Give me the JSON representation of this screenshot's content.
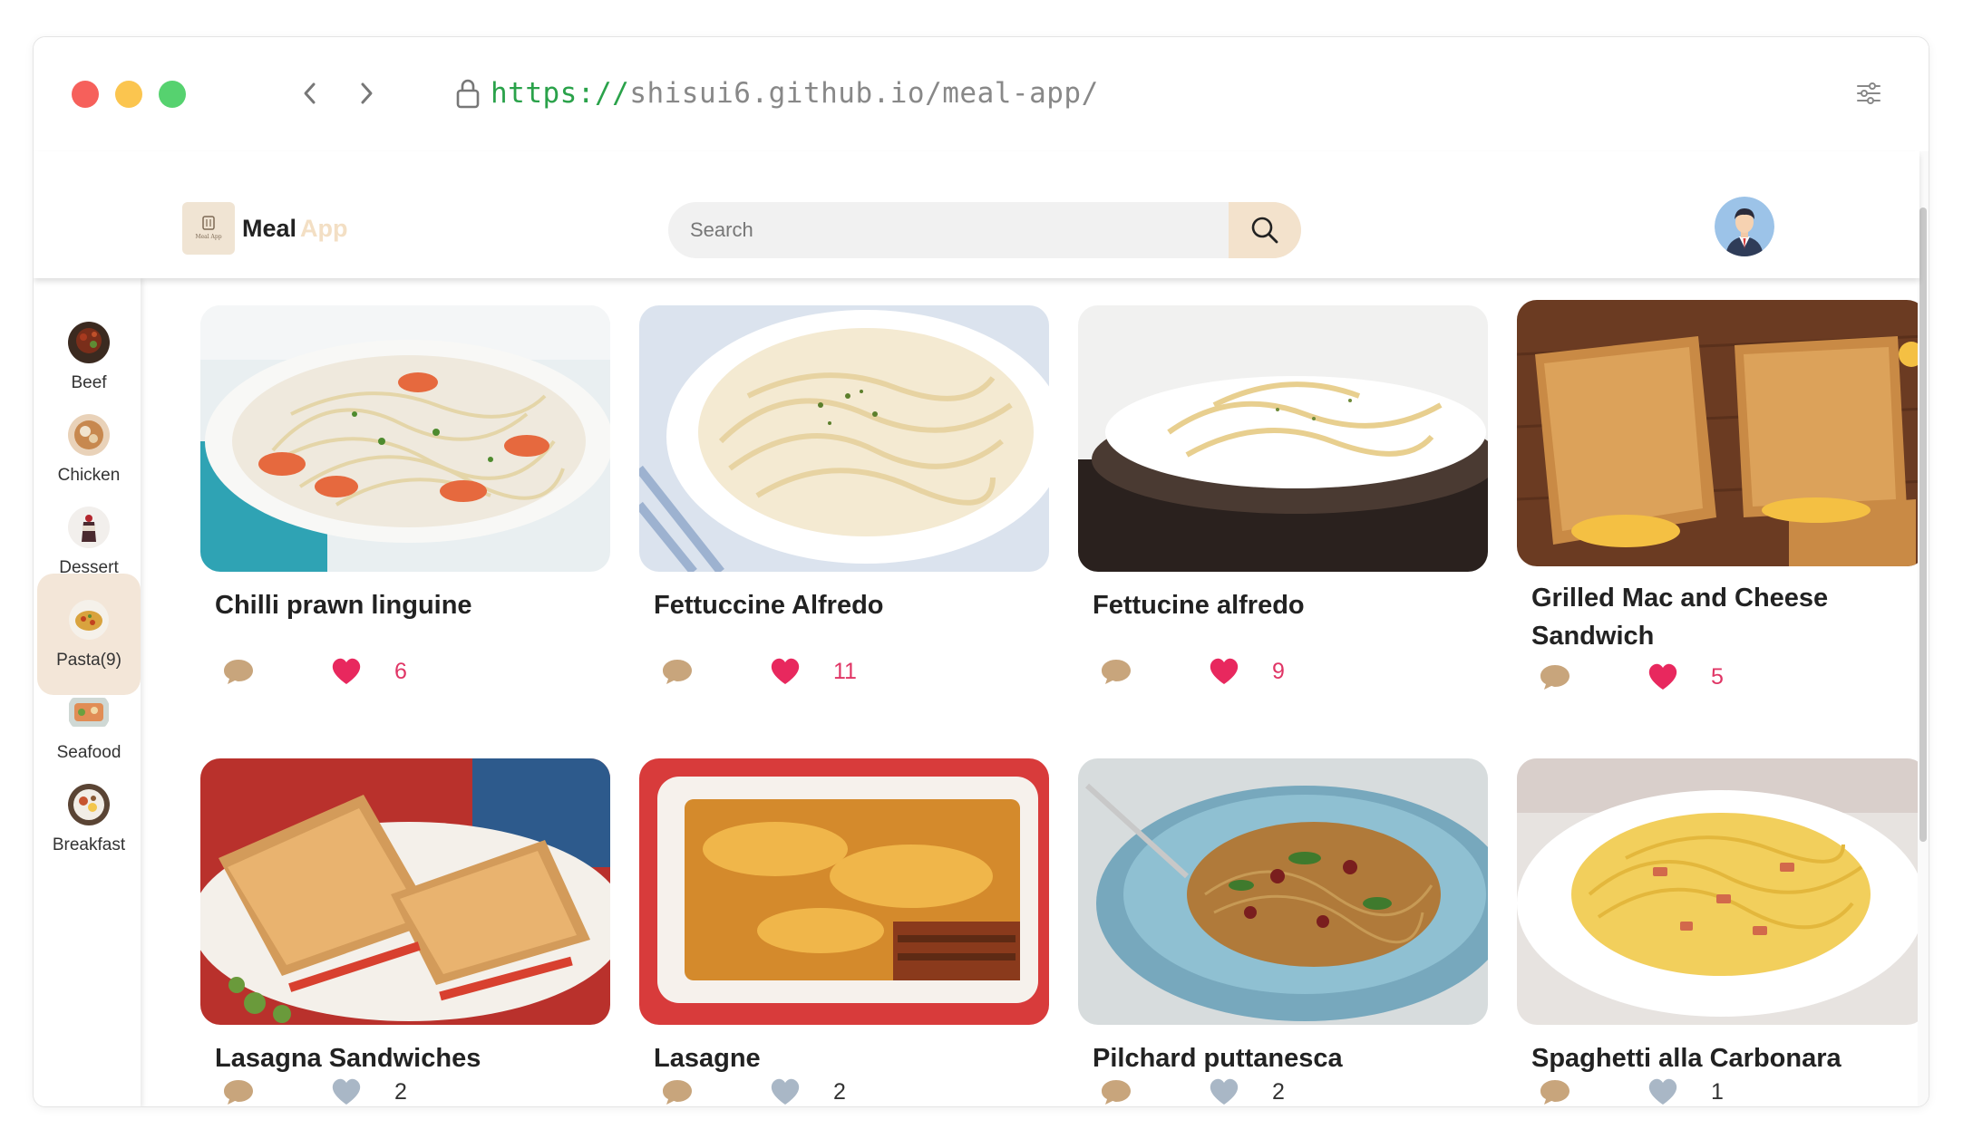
{
  "browser": {
    "url_scheme": "https://",
    "url_rest": "shisui6.github.io/meal-app/"
  },
  "header": {
    "logo_word1": "Meal",
    "logo_word2": "App",
    "logo_box_text": "Meal App",
    "search_placeholder": "Search"
  },
  "sidebar": {
    "items": [
      {
        "label": "Beef"
      },
      {
        "label": "Chicken"
      },
      {
        "label": "Dessert"
      },
      {
        "label": "Pasta(9)"
      },
      {
        "label": "Seafood"
      },
      {
        "label": "Breakfast"
      }
    ],
    "active": "Pasta(9)"
  },
  "meals": [
    {
      "title": "Chilli prawn linguine",
      "likes": "6",
      "liked": true
    },
    {
      "title": "Fettuccine Alfredo",
      "likes": "11",
      "liked": true
    },
    {
      "title": "Fettucine alfredo",
      "likes": "9",
      "liked": true
    },
    {
      "title": "Grilled Mac and Cheese Sandwich",
      "likes": "5",
      "liked": true
    },
    {
      "title": "Lasagna Sandwiches",
      "likes": "2",
      "liked": false
    },
    {
      "title": "Lasagne",
      "likes": "2",
      "liked": false
    },
    {
      "title": "Pilchard puttanesca",
      "likes": "2",
      "liked": false
    },
    {
      "title": "Spaghetti alla Carbonara",
      "likes": "1",
      "liked": false
    }
  ],
  "colors": {
    "accent": "#f3e2cc",
    "heart_liked": "#e8285e",
    "heart_unliked": "#a9b7c6",
    "comment": "#c8a57c"
  }
}
